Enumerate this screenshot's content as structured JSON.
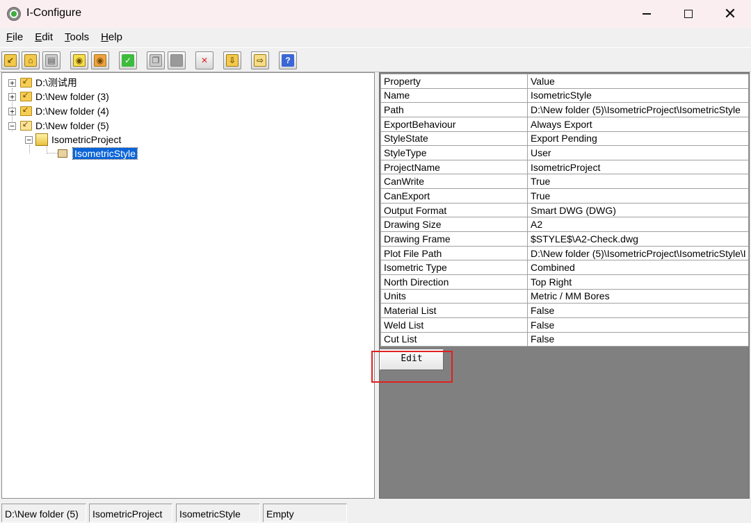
{
  "window": {
    "title": "I-Configure"
  },
  "menu": [
    {
      "pre": "",
      "u": "F",
      "post": "ile"
    },
    {
      "pre": "",
      "u": "E",
      "post": "dit"
    },
    {
      "pre": "",
      "u": "T",
      "post": "ools"
    },
    {
      "pre": "",
      "u": "H",
      "post": "elp"
    }
  ],
  "toolbar": [
    "new-folder-icon",
    "open-folder-icon",
    "properties-icon",
    "add-project-icon",
    "add-style-icon",
    "check-icon",
    "copy-icon",
    "paste-icon",
    "delete-icon",
    "export-icon",
    "import-icon",
    "help-icon"
  ],
  "tree": {
    "items": [
      {
        "label": "D:\\测试用",
        "expander": "+"
      },
      {
        "label": "D:\\New folder (3)",
        "expander": "+"
      },
      {
        "label": "D:\\New folder (4)",
        "expander": "+"
      },
      {
        "label": "D:\\New folder (5)",
        "expander": "−"
      },
      {
        "label": "IsometricProject",
        "expander": "−"
      },
      {
        "label": "IsometricStyle"
      }
    ]
  },
  "properties": {
    "header": {
      "property": "Property",
      "value": "Value"
    },
    "rows": [
      {
        "property": "Name",
        "value": "IsometricStyle"
      },
      {
        "property": "Path",
        "value": "D:\\New folder (5)\\IsometricProject\\IsometricStyle"
      },
      {
        "property": "ExportBehaviour",
        "value": "Always Export"
      },
      {
        "property": "StyleState",
        "value": "Export Pending"
      },
      {
        "property": "StyleType",
        "value": "User"
      },
      {
        "property": "ProjectName",
        "value": "IsometricProject"
      },
      {
        "property": "CanWrite",
        "value": "True"
      },
      {
        "property": "CanExport",
        "value": "True"
      },
      {
        "property": "Output Format",
        "value": "Smart DWG (DWG)"
      },
      {
        "property": "Drawing Size",
        "value": "A2"
      },
      {
        "property": "Drawing Frame",
        "value": "$STYLE$\\A2-Check.dwg"
      },
      {
        "property": "Plot File Path",
        "value": "D:\\New folder (5)\\IsometricProject\\IsometricStyle\\I"
      },
      {
        "property": "Isometric Type",
        "value": "Combined"
      },
      {
        "property": "North Direction",
        "value": "Top Right"
      },
      {
        "property": "Units",
        "value": "Metric / MM Bores"
      },
      {
        "property": "Material List",
        "value": "False"
      },
      {
        "property": "Weld List",
        "value": "False"
      },
      {
        "property": "Cut List",
        "value": "False"
      }
    ],
    "edit_label": "Edit"
  },
  "status": [
    "D:\\New folder (5)",
    "IsometricProject",
    "IsometricStyle",
    "Empty"
  ]
}
